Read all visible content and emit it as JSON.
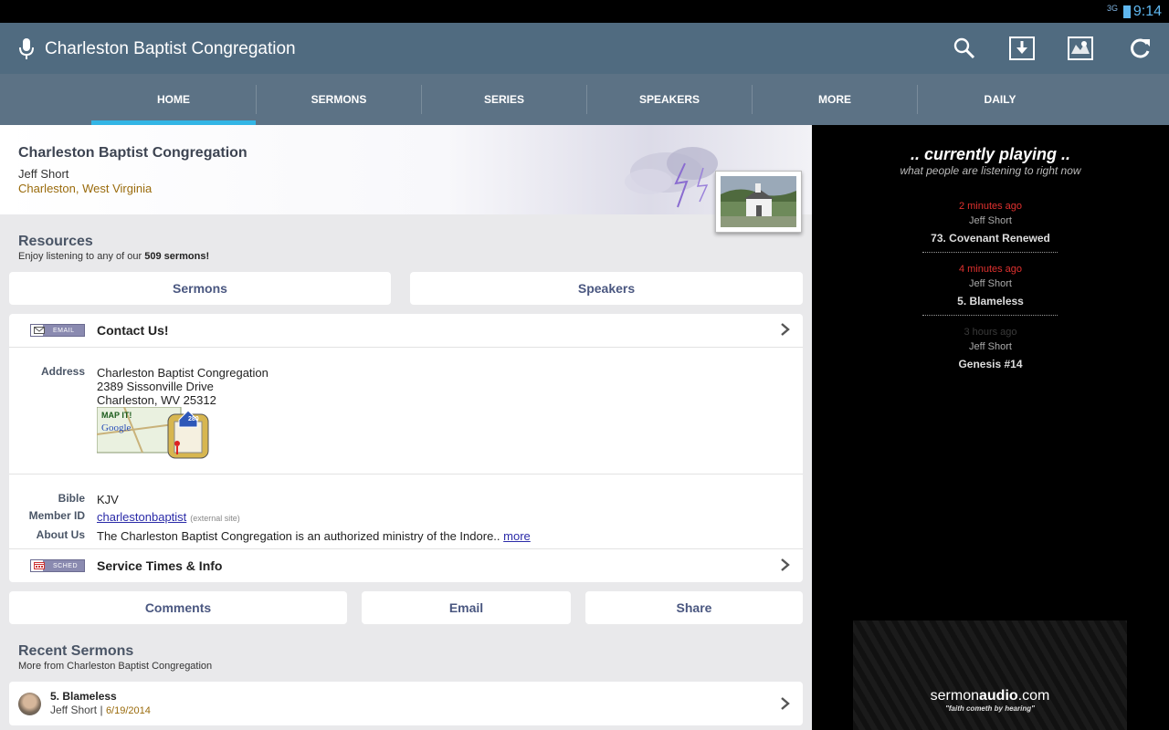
{
  "status_bar": {
    "network": "3G",
    "time": "9:14"
  },
  "action_bar": {
    "title": "Charleston Baptist Congregation",
    "icons": [
      "mic-icon",
      "search-icon",
      "download-icon",
      "map-icon",
      "refresh-icon"
    ]
  },
  "tabs": [
    {
      "label": "HOME",
      "active": true
    },
    {
      "label": "SERMONS"
    },
    {
      "label": "SERIES"
    },
    {
      "label": "SPEAKERS"
    },
    {
      "label": "MORE"
    },
    {
      "label": "DAILY"
    }
  ],
  "header": {
    "church_name": "Charleston Baptist Congregation",
    "pastor": "Jeff Short",
    "location": "Charleston, West Virginia"
  },
  "resources": {
    "title": "Resources",
    "subtitle_prefix": "Enjoy listening to any of our ",
    "subtitle_count": "509 sermons!",
    "buttons": {
      "sermons": "Sermons",
      "speakers": "Speakers"
    }
  },
  "contact": {
    "badge": "EMAIL",
    "label": "Contact Us!",
    "address_label": "Address",
    "address_lines": [
      "Charleston Baptist Congregation",
      "2389 Sissonville Drive",
      "Charleston, WV 25312"
    ],
    "map_label": "MAP IT!",
    "map_brand": "Google",
    "highway": "280",
    "bible_label": "Bible",
    "bible_value": "KJV",
    "member_label": "Member ID",
    "member_value": "charlestonbaptist",
    "member_note": "(external site)",
    "about_label": "About Us",
    "about_value": "The Charleston Baptist Congregation is an authorized ministry of the Indore..",
    "about_more": "more",
    "service_badge": "SCHED",
    "service_label": "Service Times & Info"
  },
  "actions": {
    "comments": "Comments",
    "email": "Email",
    "share": "Share"
  },
  "recent": {
    "title": "Recent Sermons",
    "subtitle": "More from Charleston Baptist Congregation",
    "items": [
      {
        "title": "5. Blameless",
        "speaker": "Jeff Short",
        "sep": " | ",
        "date": "6/19/2014"
      }
    ]
  },
  "currently_playing": {
    "title": ".. currently playing ..",
    "subtitle": "what people are listening to right now",
    "items": [
      {
        "time": "2 minutes ago",
        "speaker": "Jeff Short",
        "sermon": "73. Covenant Renewed",
        "time_color": "#e0312f"
      },
      {
        "time": "4 minutes ago",
        "speaker": "Jeff Short",
        "sermon": "5. Blameless",
        "time_color": "#e0312f"
      },
      {
        "time": "3 hours ago",
        "speaker": "Jeff Short",
        "sermon": "Genesis #14",
        "time_color": "#3a3a3a"
      }
    ]
  },
  "brand": {
    "name_light": "sermon",
    "name_bold": "audio",
    "name_suffix": ".com",
    "tagline": "\"faith cometh by hearing\""
  },
  "colors": {
    "action_bar": "#506b80",
    "tabs": "#5c7285",
    "tab_indicator": "#33b5e5",
    "status_time": "#5fb7ef",
    "location": "#9a6b0c"
  }
}
